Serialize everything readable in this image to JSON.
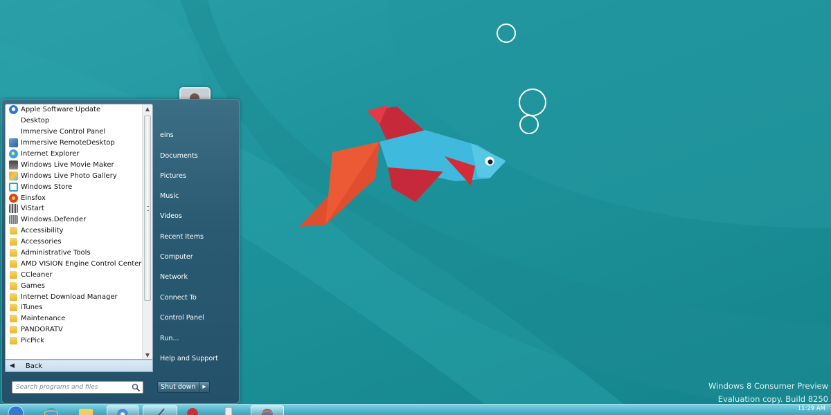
{
  "desktop": {
    "watermark_line1": "Windows 8 Consumer Preview",
    "watermark_line2": "Evaluation copy. Build 8250"
  },
  "start_menu": {
    "programs": [
      {
        "label": "Apple Software Update",
        "icon": "apple-update-icon"
      },
      {
        "label": "Desktop",
        "icon": "none"
      },
      {
        "label": "Immersive Control Panel",
        "icon": "none"
      },
      {
        "label": "Immersive RemoteDesktop",
        "icon": "control-panel-icon"
      },
      {
        "label": "Internet Explorer",
        "icon": "internet-explorer-icon"
      },
      {
        "label": "Windows Live Movie Maker",
        "icon": "movie-maker-icon"
      },
      {
        "label": "Windows Live Photo Gallery",
        "icon": "photo-gallery-icon"
      },
      {
        "label": "Windows Store",
        "icon": "store-icon"
      },
      {
        "label": "Einsfox",
        "icon": "firefox-icon"
      },
      {
        "label": "ViStart",
        "icon": "vistart-icon"
      },
      {
        "label": "Windows.Defender",
        "icon": "defender-icon"
      },
      {
        "label": "Accessibility",
        "icon": "folder-icon"
      },
      {
        "label": "Accessories",
        "icon": "folder-icon"
      },
      {
        "label": "Administrative Tools",
        "icon": "folder-icon"
      },
      {
        "label": "AMD VISION Engine Control Center",
        "icon": "folder-icon"
      },
      {
        "label": "CCleaner",
        "icon": "folder-icon"
      },
      {
        "label": "Games",
        "icon": "folder-icon"
      },
      {
        "label": "Internet Download Manager",
        "icon": "folder-icon"
      },
      {
        "label": "iTunes",
        "icon": "folder-icon"
      },
      {
        "label": "Maintenance",
        "icon": "folder-icon"
      },
      {
        "label": "PANDORATV",
        "icon": "folder-icon"
      },
      {
        "label": "PicPick",
        "icon": "folder-icon"
      }
    ],
    "back_label": "Back",
    "search_placeholder": "Search programs and files",
    "right_items": [
      "eins",
      "Documents",
      "Pictures",
      "Music",
      "Videos",
      "Recent Items",
      "Computer",
      "Network",
      "Connect To",
      "Control Panel",
      "Run...",
      "Help and Support"
    ],
    "shutdown_label": "Shut down"
  },
  "taskbar": {
    "clock": "11:29 AM"
  },
  "colors": {
    "desktop_teal": "#1e939b",
    "fish_body": "#3fb9dd",
    "fish_red": "#c62a3a",
    "fish_orange": "#e04e2f",
    "menu_blue": "#2a5b73"
  }
}
